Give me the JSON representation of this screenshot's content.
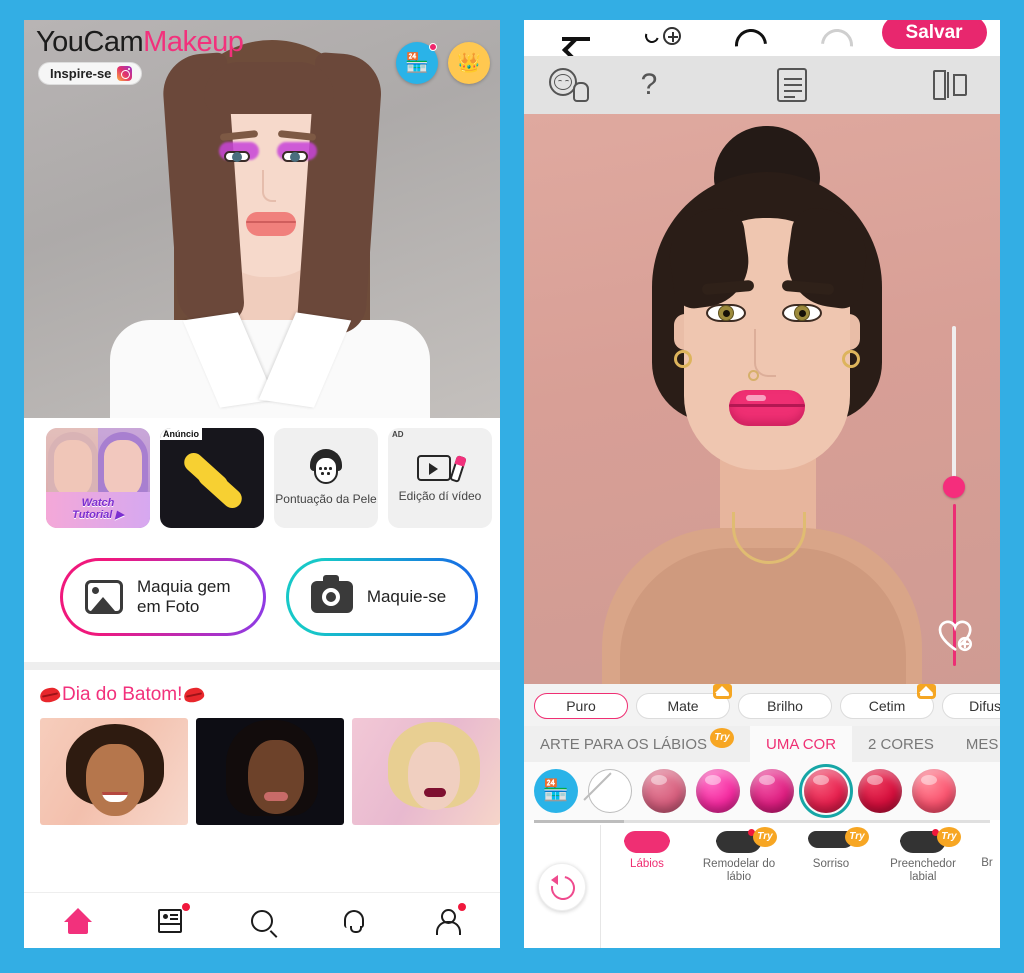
{
  "theme": {
    "background": "#33aee4",
    "accent_pink": "#f2317c",
    "save_pink": "#e8276e",
    "teal": "#16a6a6"
  },
  "left_app": {
    "brand": {
      "part1": "YouCam",
      "part2": "Makeup"
    },
    "inspire_chip": {
      "label": "Inspire-se",
      "icon": "instagram-icon"
    },
    "header_buttons": [
      {
        "name": "shop-button",
        "glyph": "🏪",
        "badge": true
      },
      {
        "name": "premium-crown-button",
        "glyph": "👑",
        "badge": false
      }
    ],
    "cards": [
      {
        "name": "watch-tutorial-card",
        "badge": "",
        "line1": "Watch",
        "line2": "Tutorial ▶",
        "label": ""
      },
      {
        "name": "ad-card",
        "badge": "Anúncio",
        "label": ""
      },
      {
        "name": "skin-score-card",
        "badge": "",
        "label": "Pontuação da Pele"
      },
      {
        "name": "video-edit-card",
        "badge": "AD",
        "label": "Edição dí vídeo"
      }
    ],
    "primary_buttons": [
      {
        "name": "makeup-on-photo-button",
        "label": "Maquia gem em Foto",
        "icon": "photo-icon"
      },
      {
        "name": "makeup-live-button",
        "label": "Maquie-se",
        "icon": "camera-icon"
      }
    ],
    "section": {
      "title": "Dia do Batom!",
      "emoji": "kiss-lips-icon",
      "thumbs": [
        {
          "name": "batom-thumb-1"
        },
        {
          "name": "batom-thumb-2"
        },
        {
          "name": "batom-thumb-3"
        }
      ]
    },
    "tabbar": [
      {
        "name": "tab-home",
        "icon": "home-icon",
        "active": true,
        "badge": false
      },
      {
        "name": "tab-feed",
        "icon": "news-icon",
        "active": false,
        "badge": true
      },
      {
        "name": "tab-search",
        "icon": "search-icon",
        "active": false,
        "badge": false
      },
      {
        "name": "tab-notifications",
        "icon": "bell-icon",
        "active": false,
        "badge": false
      },
      {
        "name": "tab-profile",
        "icon": "user-icon",
        "active": false,
        "badge": true
      }
    ]
  },
  "right_app": {
    "topbar": {
      "back": "back-arrow-icon",
      "compare": "add-compare-icon",
      "undo": "undo-icon",
      "redo": "redo-icon",
      "save_label": "Salvar"
    },
    "tools": [
      {
        "name": "tutorial-hand-icon"
      },
      {
        "name": "help-question-icon",
        "glyph": "?"
      },
      {
        "name": "looks-document-icon"
      },
      {
        "name": "before-after-split-icon"
      }
    ],
    "editor": {
      "slider_name": "intensity-slider",
      "favorite_button": "add-to-favorites-heart-icon"
    },
    "finishes": [
      {
        "label": "Puro",
        "active": true,
        "premium": false
      },
      {
        "label": "Mate",
        "active": false,
        "premium": true
      },
      {
        "label": "Brilho",
        "active": false,
        "premium": false
      },
      {
        "label": "Cetim",
        "active": false,
        "premium": true
      },
      {
        "label": "Difuso",
        "active": false,
        "premium": false
      }
    ],
    "subtabs": [
      {
        "label": "ARTE PARA OS LÁBIOS",
        "selected": false,
        "try": true
      },
      {
        "label": "UMA COR",
        "selected": true,
        "try": false
      },
      {
        "label": "2 CORES",
        "selected": false,
        "try": false
      },
      {
        "label": "MES",
        "selected": false,
        "try": false
      }
    ],
    "swatches": [
      {
        "name": "swatch-shop",
        "type": "shop",
        "color": "#2ab3e8",
        "glyph": "🏪"
      },
      {
        "name": "swatch-none",
        "type": "none",
        "color": "#ffffff"
      },
      {
        "name": "swatch-1",
        "type": "color",
        "color": "#d8607f"
      },
      {
        "name": "swatch-2",
        "type": "color",
        "color": "#f52ba0"
      },
      {
        "name": "swatch-3",
        "type": "color",
        "color": "#e01f82"
      },
      {
        "name": "swatch-4",
        "type": "color",
        "color": "#e8214f",
        "selected": true
      },
      {
        "name": "swatch-5",
        "type": "color",
        "color": "#d60f3d"
      },
      {
        "name": "swatch-6",
        "type": "color",
        "color": "#fb5570"
      }
    ],
    "bottom": {
      "reset_label": "revert-icon",
      "items": [
        {
          "label": "Lábios",
          "active": true,
          "try": false,
          "dot": false
        },
        {
          "label": "Remodelar do lábio",
          "active": false,
          "try": true,
          "dot": true
        },
        {
          "label": "Sorriso",
          "active": false,
          "try": true,
          "dot": false
        },
        {
          "label": "Preenchedor labial",
          "active": false,
          "try": true,
          "dot": true
        },
        {
          "label": "Br",
          "active": false,
          "try": false,
          "dot": false
        }
      ]
    }
  }
}
